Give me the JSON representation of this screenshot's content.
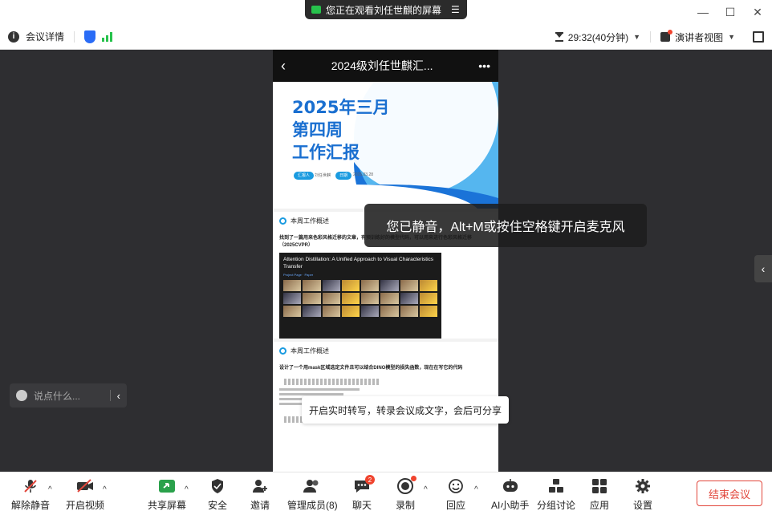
{
  "titlebar": {
    "share_banner": "您正在观看刘任世麒的屏幕",
    "share_menu_icon": "menu-icon",
    "minimize": "—",
    "maximize": "☐",
    "close": "✕"
  },
  "infobar": {
    "meeting_details": "会议详情",
    "timer": "29:32(40分钟)",
    "view_mode": "演讲者视图"
  },
  "phone": {
    "header_title": "2024级刘任世麒汇...",
    "more": "•••",
    "slide1": {
      "title": "2025年三月\n第四周\n工作汇报",
      "pill1": "汇报人",
      "meta1": "刘任世麒",
      "pill2": "日期",
      "meta2": "2025.03.28"
    },
    "slide2": {
      "title": "本周工作概述",
      "text": "找到了一篇用来色彩风格迁移的文章，有预训练好的模型代码，可以用来进行色彩风格迁移（2025CVPR）",
      "paper_title": "Attention Distillation: A Unified Approach to Visual Characteristics Transfer",
      "paper_links": "Project Page · Paper"
    },
    "slide3": {
      "title": "本周工作概述",
      "text": "设计了一个用mask区域选定文件且可以结合DINO模型的损失函数，现在在写它的代码"
    }
  },
  "overlays": {
    "mute_toast": "您已静音，Alt+M或按住空格键开启麦克风",
    "chat_placeholder": "说点什么...",
    "transcribe_tip": "开启实时转写，转录会议成文字，会后可分享"
  },
  "toolbar": {
    "unmute": "解除静音",
    "video": "开启视频",
    "share": "共享屏幕",
    "security": "安全",
    "invite": "邀请",
    "members": "管理成员(8)",
    "chat": "聊天",
    "chat_badge": "2",
    "record": "录制",
    "react": "回应",
    "ai": "AI小助手",
    "breakout": "分组讨论",
    "apps": "应用",
    "settings": "设置",
    "end": "结束会议"
  },
  "colors": {
    "accent_blue": "#2a6cf6",
    "end_red": "#e2463b",
    "signal_green": "#27c24c",
    "main_bg": "#2e2e31"
  }
}
